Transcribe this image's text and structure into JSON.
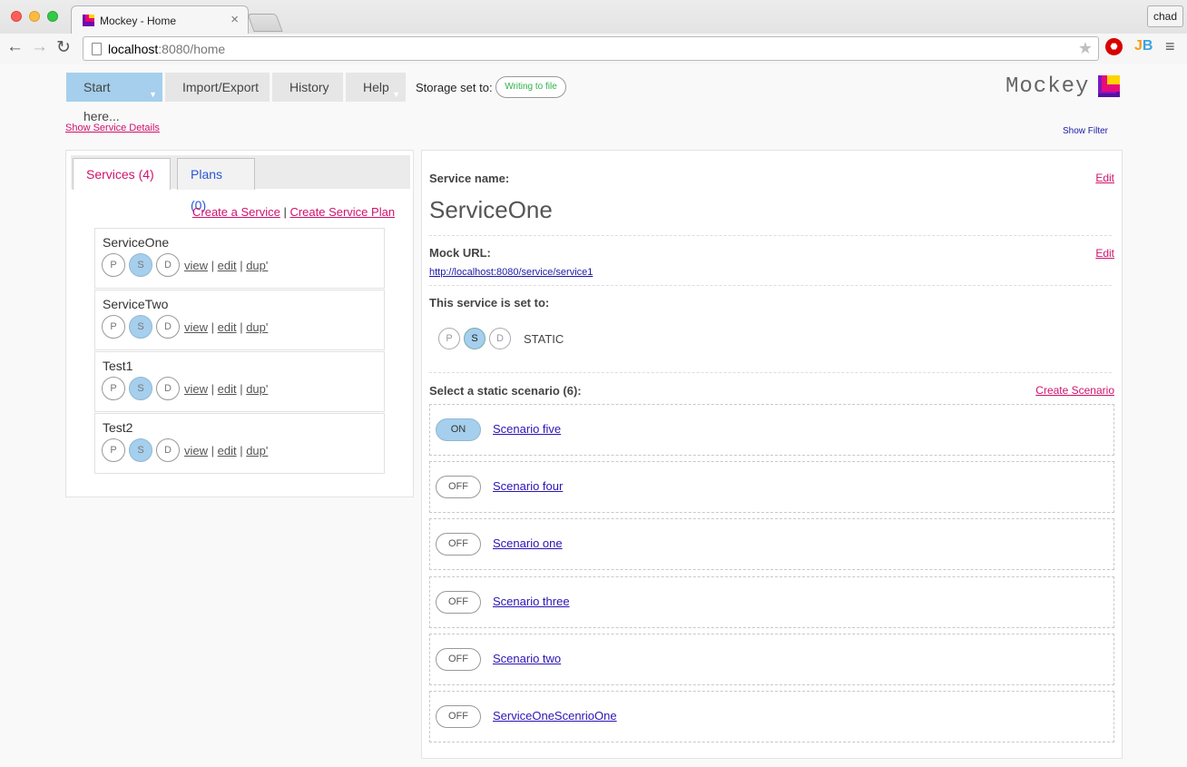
{
  "browser": {
    "tab_title": "Mockey - Home",
    "tab_close": "×",
    "user_button": "chad",
    "url_host": "localhost",
    "url_rest": ":8080/home",
    "star": "★",
    "ext_stop": "⬣",
    "ext_jb_j": "J",
    "ext_jb_b": "B",
    "menu": "≡",
    "back": "←",
    "forward": "→",
    "reload": "↻"
  },
  "nav": {
    "start": "Start here...",
    "import_export": "Import/Export",
    "history": "History",
    "help": "Help",
    "caret": "▼",
    "storage_label": "Storage set to:",
    "storage_value": "Writing to file"
  },
  "logo": {
    "text": "Mockey"
  },
  "links": {
    "show_service_details": "Show Service Details",
    "show_filter": "Show Filter"
  },
  "left": {
    "tab_services": "Services (4)",
    "tab_plans": "Plans (0)",
    "create_service": "Create a Service",
    "sep": " | ",
    "create_plan": "Create Service Plan",
    "services": [
      {
        "name": "ServiceOne"
      },
      {
        "name": "ServiceTwo"
      },
      {
        "name": "Test1"
      },
      {
        "name": "Test2"
      }
    ],
    "modes": [
      "P",
      "S",
      "D"
    ],
    "active_mode": "S",
    "view": "view",
    "edit": "edit",
    "dup": "dup'",
    "pipe": " | "
  },
  "right": {
    "service_name_label": "Service name:",
    "edit": "Edit",
    "service_name": "ServiceOne",
    "mock_url_label": "Mock URL:",
    "mock_url": "http://localhost:8080/service/service1",
    "set_to_label": "This service is set to:",
    "modes": [
      "P",
      "S",
      "D"
    ],
    "status": "STATIC",
    "select_label": "Select a static scenario (6):",
    "create_scenario": "Create Scenario",
    "scenarios": [
      {
        "state": "ON",
        "name": "Scenario five"
      },
      {
        "state": "OFF",
        "name": "Scenario four"
      },
      {
        "state": "OFF",
        "name": "Scenario one"
      },
      {
        "state": "OFF",
        "name": "Scenario three"
      },
      {
        "state": "OFF",
        "name": "Scenario two"
      },
      {
        "state": "OFF",
        "name": "ServiceOneScenrioOne"
      }
    ]
  },
  "colors": {
    "accent_pink": "#d0116c",
    "active_blue": "#a5cfec",
    "link_purple": "#2b14b4",
    "storage_green": "#2db34a"
  }
}
